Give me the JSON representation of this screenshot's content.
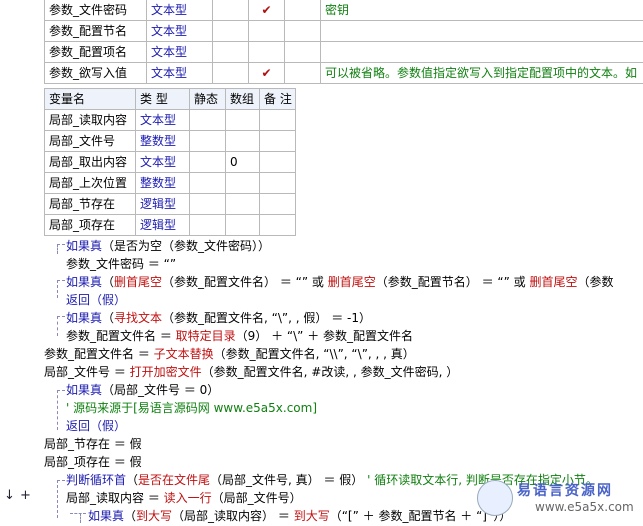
{
  "params_table": {
    "rows": [
      {
        "name": "参数_文件密码",
        "type": "文本型",
        "ref": "",
        "nullable": "✔",
        "array": "",
        "note": "密钥"
      },
      {
        "name": "参数_配置节名",
        "type": "文本型",
        "ref": "",
        "nullable": "",
        "array": "",
        "note": ""
      },
      {
        "name": "参数_配置项名",
        "type": "文本型",
        "ref": "",
        "nullable": "",
        "array": "",
        "note": ""
      },
      {
        "name": "参数_欲写入值",
        "type": "文本型",
        "ref": "",
        "nullable": "✔",
        "array": "",
        "note": "可以被省略。参数值指定欲写入到指定配置项中的文本。如"
      }
    ]
  },
  "locals_table": {
    "headers": [
      "变量名",
      "类 型",
      "静态",
      "数组",
      "备 注"
    ],
    "rows": [
      {
        "name": "局部_读取内容",
        "type": "文本型",
        "static": "",
        "array": "",
        "note": ""
      },
      {
        "name": "局部_文件号",
        "type": "整数型",
        "static": "",
        "array": "",
        "note": ""
      },
      {
        "name": "局部_取出内容",
        "type": "文本型",
        "static": "",
        "array": "0",
        "note": ""
      },
      {
        "name": "局部_上次位置",
        "type": "整数型",
        "static": "",
        "array": "",
        "note": ""
      },
      {
        "name": "局部_节存在",
        "type": "逻辑型",
        "static": "",
        "array": "",
        "note": ""
      },
      {
        "name": "局部_项存在",
        "type": "逻辑型",
        "static": "",
        "array": "",
        "note": ""
      }
    ]
  },
  "code": {
    "l1_kw": "如果真",
    "l1_rest": "（是否为空（参数_文件密码））",
    "l2": "参数_文件密码 ＝ “”",
    "l3_kw": "如果真",
    "l3_a": "（",
    "l3_f1": "删首尾空",
    "l3_b": "（参数_配置文件名） ＝ “” 或 ",
    "l3_f2": "删首尾空",
    "l3_c": "（参数_配置节名） ＝ “” 或 ",
    "l3_f3": "删首尾空",
    "l3_d": "（参数",
    "l4": "返回（假）",
    "l5_kw": "如果真",
    "l5_a": "（",
    "l5_f": "寻找文本",
    "l5_b": "（参数_配置文件名, “\\”, , 假） ＝ -1）",
    "l6_a": "参数_配置文件名 ＝ ",
    "l6_f": "取特定目录",
    "l6_b": "（9） ＋ “\\” ＋ 参数_配置文件名",
    "l7_a": "参数_配置文件名 ＝ ",
    "l7_f": "子文本替换",
    "l7_b": "（参数_配置文件名, “\\\\”, “\\”, , , 真）",
    "l8_a": "局部_文件号 ＝ ",
    "l8_f": "打开加密文件",
    "l8_b": "（参数_配置文件名, #改读, , 参数_文件密码, ）",
    "l9_kw": "如果真",
    "l9_rest": "（局部_文件号 ＝ 0）",
    "l10": "' 源码来源于[易语言源码网 www.e5a5x.com]",
    "l11": "返回（假）",
    "l12": "局部_节存在 ＝ 假",
    "l13": "局部_项存在 ＝ 假",
    "l14_kw": "判断循环首",
    "l14_a": "（",
    "l14_f": "是否在文件尾",
    "l14_b": "（局部_文件号, 真） ＝ 假） ",
    "l14_c": "' 循环读取文本行, 判断是否存在指定小节。",
    "l15_a": "局部_读取内容 ＝ ",
    "l15_f": "读入一行",
    "l15_b": "（局部_文件号）",
    "l16_kw": "如果真",
    "l16_a": "（",
    "l16_f1": "到大写",
    "l16_b": "（局部_读取内容） ＝ ",
    "l16_f2": "到大写",
    "l16_c": "（“[” ＋ 参数_配置节名 ＋ “]”））"
  },
  "gutter": {
    "arrow": "↓",
    "plus": "+"
  },
  "watermark": {
    "top": "易语言资源网",
    "bottom": "www.e5a5x.com"
  }
}
